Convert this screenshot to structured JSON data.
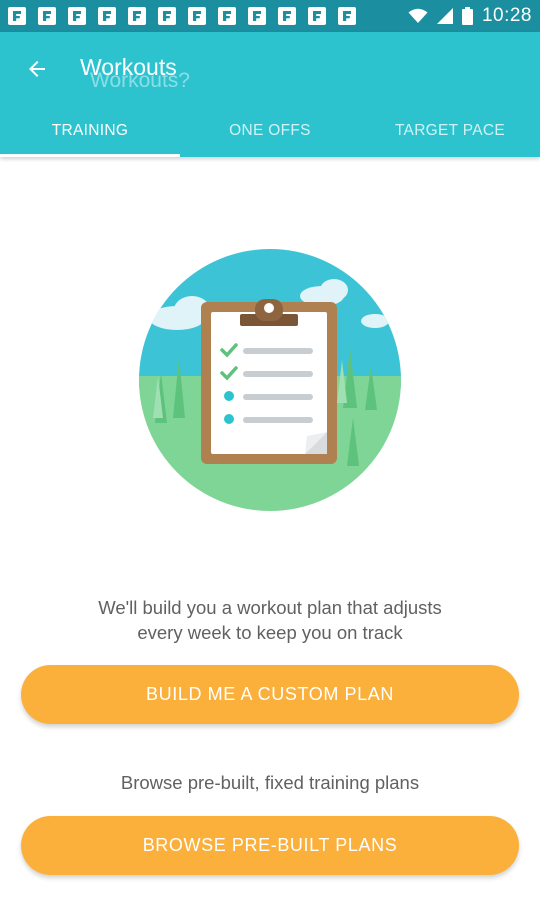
{
  "status_bar": {
    "time": "10:28",
    "notification_icons": [
      "flipboard-icon",
      "flipboard-icon",
      "flipboard-icon",
      "flipboard-icon",
      "flipboard-icon",
      "flipboard-icon",
      "flipboard-icon",
      "flipboard-icon",
      "flipboard-icon",
      "flipboard-icon",
      "flipboard-icon",
      "flipboard-icon"
    ],
    "status_icons": [
      "wifi-icon",
      "signal-icon",
      "battery-icon"
    ]
  },
  "app_bar": {
    "title": "Workouts",
    "title_ghost": "Workouts?",
    "back_icon": "arrow-back-icon",
    "tabs": [
      {
        "label": "TRAINING",
        "active": true
      },
      {
        "label": "ONE OFFS",
        "active": false
      },
      {
        "label": "TARGET PACE",
        "active": false
      }
    ]
  },
  "content": {
    "illustration_icon": "clipboard-checklist-icon",
    "custom_plan_text_1": "We'll build you a workout plan that adjusts",
    "custom_plan_text_2": "every week to keep you on track",
    "custom_plan_button": "BUILD ME A CUSTOM PLAN",
    "browse_text": "Browse pre-built, fixed training plans",
    "browse_button": "BROWSE PRE-BUILT PLANS"
  },
  "colors": {
    "status_bar": "#1b8fa0",
    "app_bar": "#2cc3cf",
    "button": "#fbb03b",
    "text": "#616161"
  }
}
